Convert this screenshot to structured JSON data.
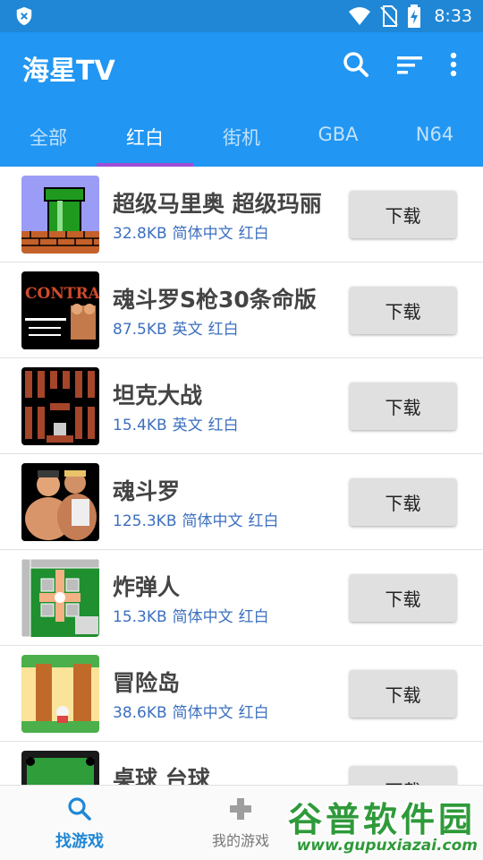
{
  "status_bar": {
    "time": "8:33",
    "icons": [
      "shield-x-icon",
      "wifi-icon",
      "no-sim-icon",
      "battery-charging-icon"
    ]
  },
  "app_bar": {
    "title": "海星TV",
    "actions": [
      "search-icon",
      "sort-icon",
      "more-vert-icon"
    ],
    "background": "#2196f3",
    "tab_indicator_color": "#9c4fd6"
  },
  "tabs": [
    {
      "label": "全部",
      "active": false
    },
    {
      "label": "红白",
      "active": true
    },
    {
      "label": "街机",
      "active": false
    },
    {
      "label": "GBA",
      "active": false
    },
    {
      "label": "N64",
      "active": false
    }
  ],
  "games": [
    {
      "name": "超级马里奥 超级玛丽",
      "size": "32.8KB",
      "language": "简体中文",
      "platform": "红白",
      "button": "下载",
      "thumb": "mario-icon"
    },
    {
      "name": "魂斗罗S枪30条命版",
      "size": "87.5KB",
      "language": "英文",
      "platform": "红白",
      "button": "下载",
      "thumb": "contra-title-icon"
    },
    {
      "name": "坦克大战",
      "size": "15.4KB",
      "language": "英文",
      "platform": "红白",
      "button": "下载",
      "thumb": "tank-icon"
    },
    {
      "name": "魂斗罗",
      "size": "125.3KB",
      "language": "简体中文",
      "platform": "红白",
      "button": "下载",
      "thumb": "contra-heroes-icon"
    },
    {
      "name": "炸弹人",
      "size": "15.3KB",
      "language": "简体中文",
      "platform": "红白",
      "button": "下载",
      "thumb": "bomberman-icon"
    },
    {
      "name": "冒险岛",
      "size": "38.6KB",
      "language": "简体中文",
      "platform": "红白",
      "button": "下载",
      "thumb": "adventure-island-icon"
    },
    {
      "name": "桌球 台球",
      "size": "",
      "language": "",
      "platform": "",
      "button": "下载",
      "thumb": "billiards-icon"
    }
  ],
  "bottom_nav": [
    {
      "label": "找游戏",
      "icon": "search-icon",
      "active": true
    },
    {
      "label": "我的游戏",
      "icon": "gamepad-icon",
      "active": false
    }
  ],
  "watermark": {
    "title": "谷普软件园",
    "url": "www.gupuxiazai.com"
  }
}
